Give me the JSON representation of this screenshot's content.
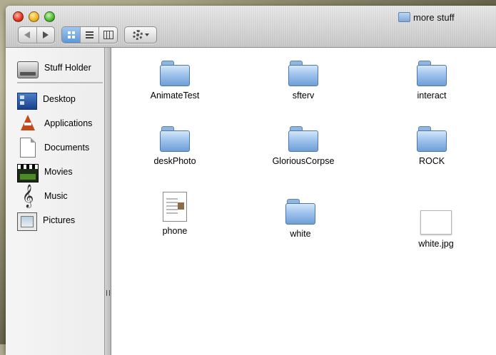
{
  "window": {
    "title": "more stuff"
  },
  "sidebar": {
    "volumes": [
      {
        "label": "Stuff Holder",
        "icon": "hard-disk-icon"
      }
    ],
    "places": [
      {
        "label": "Desktop",
        "icon": "desktop-icon"
      },
      {
        "label": "Applications",
        "icon": "applications-icon"
      },
      {
        "label": "Documents",
        "icon": "documents-icon"
      },
      {
        "label": "Movies",
        "icon": "movies-icon"
      },
      {
        "label": "Music",
        "icon": "music-icon"
      },
      {
        "label": "Pictures",
        "icon": "pictures-icon"
      }
    ]
  },
  "toolbar": {
    "view_selected": "icon-view"
  },
  "files": [
    {
      "name": "AnimateTest",
      "kind": "folder"
    },
    {
      "name": "sfterv",
      "kind": "folder"
    },
    {
      "name": "interact",
      "kind": "folder"
    },
    {
      "name": "deskPhoto",
      "kind": "folder"
    },
    {
      "name": "GloriousCorpse",
      "kind": "folder"
    },
    {
      "name": "ROCK",
      "kind": "folder"
    },
    {
      "name": "phone",
      "kind": "document"
    },
    {
      "name": "white",
      "kind": "folder"
    },
    {
      "name": "white.jpg",
      "kind": "image"
    }
  ],
  "colors": {
    "folder_blue": "#9ec3ec",
    "selected_segment": "#5c95d6",
    "close": "#e0321d",
    "minimize": "#f2b21b",
    "zoom": "#4cb92e"
  }
}
